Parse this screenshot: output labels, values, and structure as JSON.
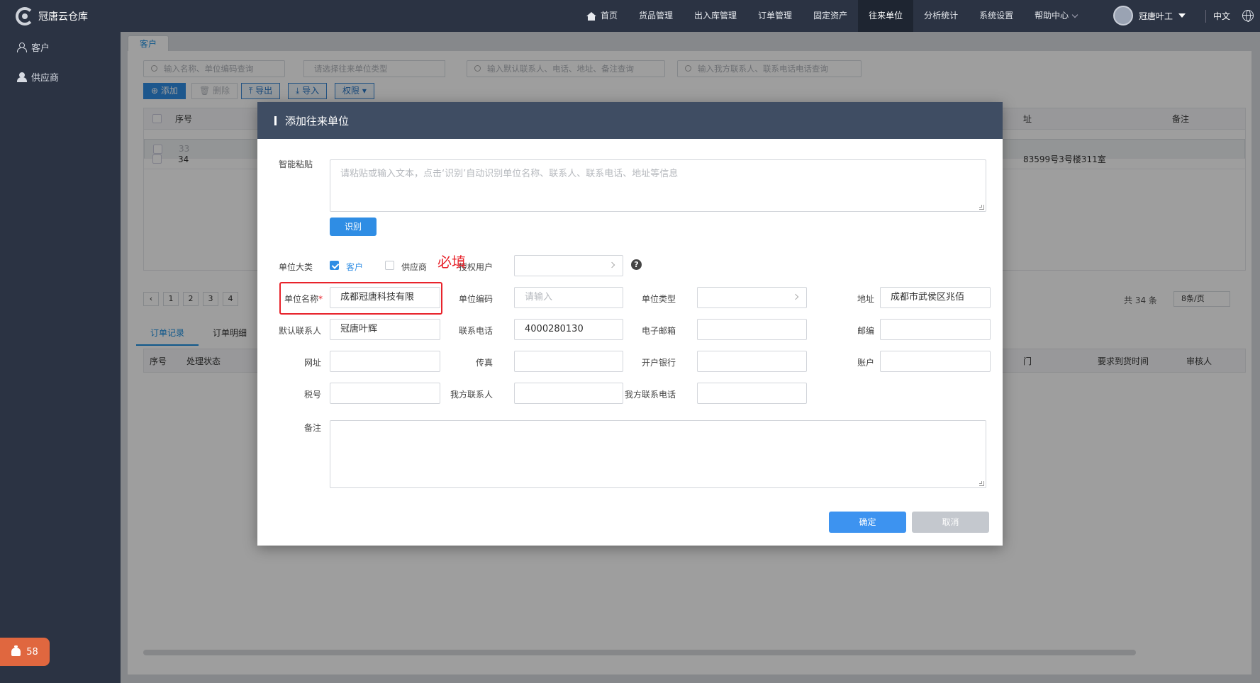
{
  "app": {
    "title": "冠唐云仓库"
  },
  "nav": {
    "items": [
      "首页",
      "货品管理",
      "出入库管理",
      "订单管理",
      "固定资产",
      "往来单位",
      "分析统计",
      "系统设置",
      "帮助中心"
    ],
    "active": "往来单位"
  },
  "user": {
    "name": "冠唐叶工",
    "lang": "中文"
  },
  "sidebar": {
    "items": [
      "客户",
      "供应商"
    ]
  },
  "notify": {
    "count": "58"
  },
  "page": {
    "tab": "客户",
    "search": {
      "name_ph": "输入名称、单位编码查询",
      "type_ph": "请选择往来单位类型",
      "contact_ph": "输入默认联系人、电话、地址、备注查询",
      "ours_ph": "输入我方联系人、联系电话电话查询"
    },
    "toolbar": {
      "add": "添加",
      "delete": "删除",
      "export": "导出",
      "import": "导入",
      "perm": "权限"
    },
    "table": {
      "headers": {
        "seq": "序号",
        "addr": "址",
        "remark": "备注"
      },
      "rows": [
        {
          "seq": "33",
          "addr": ""
        },
        {
          "seq": "34",
          "addr": "83599号3号楼311室"
        }
      ]
    },
    "pager": {
      "pages": [
        "1",
        "2",
        "3",
        "4"
      ],
      "total": "共 34 条",
      "size": "8条/页"
    },
    "subtabs": [
      "订单记录",
      "订单明细"
    ],
    "subtable": {
      "headers": [
        "序号",
        "处理状态",
        "门",
        "要求到货时间",
        "审核人"
      ]
    }
  },
  "modal": {
    "title": "添加往来单位",
    "smart_paste": {
      "label": "智能粘贴",
      "placeholder": "请粘贴或输入文本，点击‘识别’自动识别单位名称、联系人、联系电话、地址等信息",
      "button": "识别"
    },
    "category": {
      "label": "单位大类",
      "customer": "客户",
      "supplier": "供应商",
      "customer_checked": true,
      "supplier_checked": false
    },
    "annotation": "必填",
    "auth_user": {
      "label": "授权用户",
      "value": ""
    },
    "help_icon": "?",
    "fields": {
      "name": {
        "label": "单位名称",
        "required": "*",
        "value": "成都冠唐科技有限"
      },
      "code": {
        "label": "单位编码",
        "placeholder": "请输入",
        "value": ""
      },
      "type": {
        "label": "单位类型",
        "value": ""
      },
      "address": {
        "label": "地址",
        "value": "成都市武侯区兆佰"
      },
      "contact": {
        "label": "默认联系人",
        "value": "冠唐叶辉"
      },
      "phone": {
        "label": "联系电话",
        "value": "4000280130"
      },
      "email": {
        "label": "电子邮箱",
        "value": ""
      },
      "zip": {
        "label": "邮编",
        "value": ""
      },
      "website": {
        "label": "网址",
        "value": ""
      },
      "fax": {
        "label": "传真",
        "value": ""
      },
      "bank": {
        "label": "开户银行",
        "value": ""
      },
      "account": {
        "label": "账户",
        "value": ""
      },
      "tax": {
        "label": "税号",
        "value": ""
      },
      "our_contact": {
        "label": "我方联系人",
        "value": ""
      },
      "our_phone": {
        "label": "我方联系电话",
        "value": ""
      },
      "remark": {
        "label": "备注",
        "value": ""
      }
    },
    "buttons": {
      "ok": "确定",
      "cancel": "取消"
    }
  },
  "colors": {
    "topbar": "#2b3343",
    "primary": "#2f8de4",
    "modal_header": "#3f4d63",
    "highlight": "#e8232b",
    "badge": "#e0673f"
  }
}
